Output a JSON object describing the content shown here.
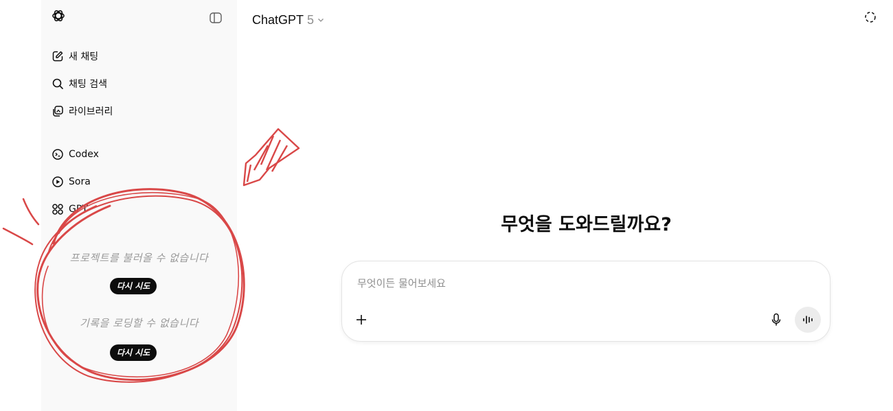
{
  "sidebar": {
    "logo_icon": "openai-logo-icon",
    "toggle_icon": "sidebar-toggle-icon",
    "items": [
      {
        "label": "새 채팅",
        "icon": "new-chat-icon"
      },
      {
        "label": "채팅 검색",
        "icon": "search-icon"
      },
      {
        "label": "라이브러리",
        "icon": "library-icon"
      },
      {
        "label": "Codex",
        "icon": "codex-icon"
      },
      {
        "label": "Sora",
        "icon": "sora-icon"
      },
      {
        "label": "GPT",
        "icon": "gpts-icon"
      }
    ],
    "projects_error": "프로젝트를 불러올 수 없습니다",
    "projects_retry": "다시 시도",
    "history_error": "기록을 로딩할 수 없습니다",
    "history_retry": "다시 시도"
  },
  "header": {
    "model_name": "ChatGPT",
    "model_version": "5",
    "temporary_chat_icon": "temporary-chat-icon"
  },
  "main": {
    "headline": "무엇을 도와드릴까요?",
    "composer": {
      "placeholder": "무엇이든 물어보세요",
      "attach_icon": "plus-icon",
      "mic_icon": "mic-icon",
      "voice_icon": "voice-mode-icon"
    }
  },
  "colors": {
    "sidebar_bg": "#f9f9f9",
    "annotation_red": "#d94848",
    "retry_bg": "#0d0d0d"
  }
}
